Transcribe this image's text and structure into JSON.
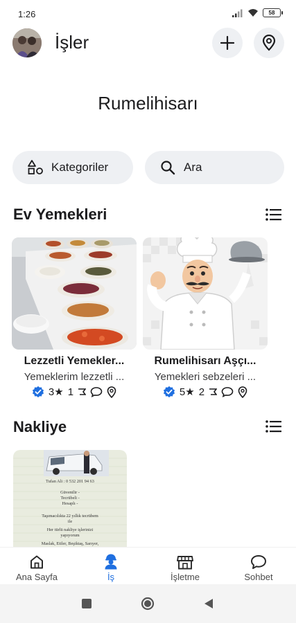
{
  "status_bar": {
    "time": "1:26",
    "battery": "58"
  },
  "header": {
    "title": "İşler"
  },
  "location": {
    "name": "Rumelihisarı"
  },
  "filters": {
    "categories_label": "Kategoriler",
    "search_label": "Ara"
  },
  "sections": [
    {
      "title": "Ev Yemekleri",
      "cards": [
        {
          "title": "Lezzetli Yemekler...",
          "description": "Yemeklerim lezzetli ...",
          "rating": "3★",
          "reviews": "1"
        },
        {
          "title": "Rumelihisarı Aşçı...",
          "description": "Yemekleri sebzeleri ...",
          "rating": "5★",
          "reviews": "2"
        }
      ]
    },
    {
      "title": "Nakliye",
      "image_lines": [
        "Tufan Ali : 0 532 201 94 63",
        "Güvenilir -",
        "Tecrübeli -",
        "Hesaplı -",
        "Taşımacılıkta 22 yıllık tecrübem",
        "ile",
        "Her türlü nakliye işlerinizi",
        "yapıyorum",
        "Maslak, Etiler, Beşiktaş, Sarıyer,"
      ]
    }
  ],
  "bottom_nav": [
    {
      "label": "Ana Sayfa",
      "icon": "home-icon"
    },
    {
      "label": "İş",
      "icon": "worker-icon"
    },
    {
      "label": "İşletme",
      "icon": "store-icon"
    },
    {
      "label": "Sohbet",
      "icon": "chat-icon"
    }
  ],
  "colors": {
    "accent": "#1f6fe0",
    "pill_bg": "#eef0f3",
    "verified": "#1f6fe0"
  }
}
